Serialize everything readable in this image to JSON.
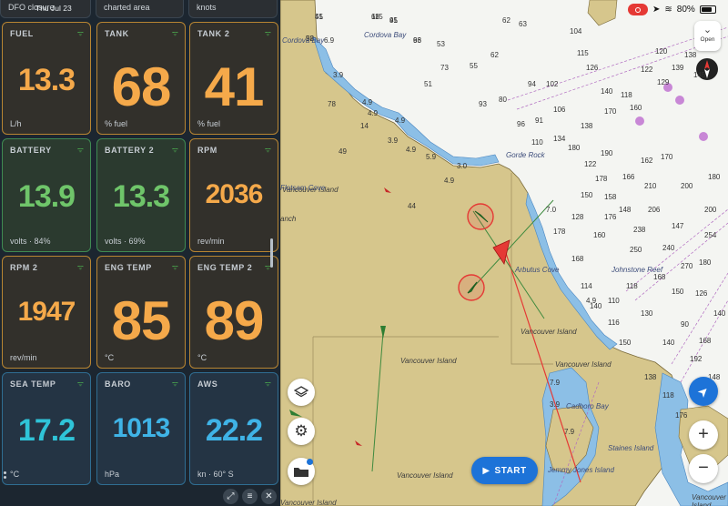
{
  "panel": {
    "top_strips": [
      {
        "text": "DFO closure",
        "overlay": "Thu Jul 23"
      },
      {
        "text": "charted area"
      },
      {
        "text": "knots"
      }
    ],
    "tiles": [
      {
        "title": "FUEL",
        "value": "13.3",
        "unit": "L/h",
        "theme": "orange"
      },
      {
        "title": "TANK",
        "value": "68",
        "unit": "% fuel",
        "theme": "orange"
      },
      {
        "title": "TANK 2",
        "value": "41",
        "unit": "% fuel",
        "theme": "orange"
      },
      {
        "title": "BATTERY",
        "value": "13.9",
        "unit": "volts · 84%",
        "theme": "green"
      },
      {
        "title": "BATTERY 2",
        "value": "13.3",
        "unit": "volts · 69%",
        "theme": "green"
      },
      {
        "title": "RPM",
        "value": "2036",
        "unit": "rev/min",
        "theme": "orange"
      },
      {
        "title": "RPM 2",
        "value": "1947",
        "unit": "rev/min",
        "theme": "orange"
      },
      {
        "title": "ENG TEMP",
        "value": "85",
        "unit": "°C",
        "theme": "orange"
      },
      {
        "title": "ENG TEMP 2",
        "value": "89",
        "unit": "°C",
        "theme": "orange"
      },
      {
        "title": "SEA TEMP",
        "value": "17.2",
        "unit": "°C",
        "theme": "blue"
      },
      {
        "title": "BARO",
        "value": "1013",
        "unit": "hPa",
        "theme": "blue"
      },
      {
        "title": "AWS",
        "value": "22.2",
        "unit": "kn · 60° S",
        "theme": "blue"
      }
    ],
    "toolbar_icons": [
      "resize-icon",
      "sliders-icon",
      "close-icon"
    ]
  },
  "map": {
    "places": [
      {
        "text": "Cordova Bay",
        "color": "blue"
      },
      {
        "text": "Cordova Bay",
        "color": "blue"
      },
      {
        "text": "Gorde Rock",
        "color": "blue"
      },
      {
        "text": "Arbutus Cove",
        "color": "blue"
      },
      {
        "text": "Johnstone Reef",
        "color": "blue"
      },
      {
        "text": "Vancouver Island",
        "color": "gray"
      },
      {
        "text": "Vancouver Island",
        "color": "gray"
      },
      {
        "text": "Vancouver Island",
        "color": "gray"
      },
      {
        "text": "Vancouver Island",
        "color": "gray"
      },
      {
        "text": "Cadboro Bay",
        "color": "blue"
      },
      {
        "text": "Staines Island",
        "color": "blue"
      },
      {
        "text": "Jemmy Jones Island",
        "color": "blue"
      },
      {
        "text": "Flotsam Cove",
        "color": "blue"
      },
      {
        "text": "anch",
        "color": "gray"
      },
      {
        "text": "Vancouver Island",
        "color": "gray"
      },
      {
        "text": "Vancouver Island",
        "color": "gray"
      },
      {
        "text": "Vancouver Island",
        "color": "gray"
      }
    ],
    "depths": [
      "45",
      "58",
      "68",
      "45",
      "63",
      "53",
      "73",
      "51",
      "55",
      "62",
      "62",
      "63",
      "93",
      "80",
      "94",
      "102",
      "106",
      "91",
      "96",
      "110",
      "134",
      "104",
      "115",
      "126",
      "140",
      "118",
      "122",
      "120",
      "139",
      "138",
      "145",
      "129",
      "160",
      "170",
      "138",
      "180",
      "122",
      "190",
      "178",
      "166",
      "162",
      "170",
      "210",
      "200",
      "180",
      "206",
      "148",
      "238",
      "147",
      "240",
      "270",
      "254",
      "200",
      "180",
      "250",
      "176",
      "158",
      "150",
      "128",
      "160",
      "168",
      "178",
      "168",
      "150",
      "126",
      "140",
      "114",
      "140",
      "116",
      "150",
      "130",
      "140",
      "90",
      "168",
      "192",
      "148",
      "138",
      "118",
      "190",
      "176",
      "110",
      "118",
      "6.9",
      "3.9",
      "4.9",
      "4.9",
      "4.9",
      "3.9",
      "4.9",
      "5.9",
      "4.9",
      "3.0",
      "4.9",
      "7.0",
      "7.9",
      "3.9",
      "7.9",
      "49",
      "78",
      "14",
      "44",
      "51",
      "92",
      "115",
      "91",
      "96"
    ],
    "start_label": "START",
    "open_label": "Open",
    "compass_label": "N",
    "status_battery": "80%",
    "zoom_in": "+",
    "zoom_out": "−",
    "side_buttons": [
      "layers-icon",
      "gear-icon",
      "folder-icon"
    ]
  }
}
